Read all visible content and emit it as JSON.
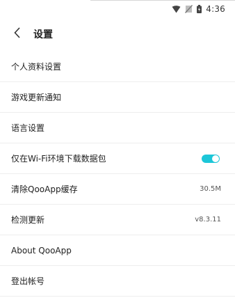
{
  "status_bar": {
    "time": "4:36",
    "icons": [
      "wifi-icon",
      "no-sim-icon",
      "battery-icon"
    ]
  },
  "app_bar": {
    "back_icon": "chevron-left-icon",
    "title": "设置"
  },
  "settings": {
    "items": [
      {
        "label": "个人资料设置"
      },
      {
        "label": "游戏更新通知"
      },
      {
        "label": "语言设置"
      },
      {
        "label": "仅在Wi-Fi环境下载数据包",
        "toggle_on": true,
        "toggle_color": "#1cc6d8"
      },
      {
        "label": "清除QooApp缓存",
        "value": "30.5M"
      },
      {
        "label": "检测更新",
        "value": "v8.3.11"
      },
      {
        "label": "About QooApp"
      },
      {
        "label": "登出帐号"
      }
    ]
  }
}
